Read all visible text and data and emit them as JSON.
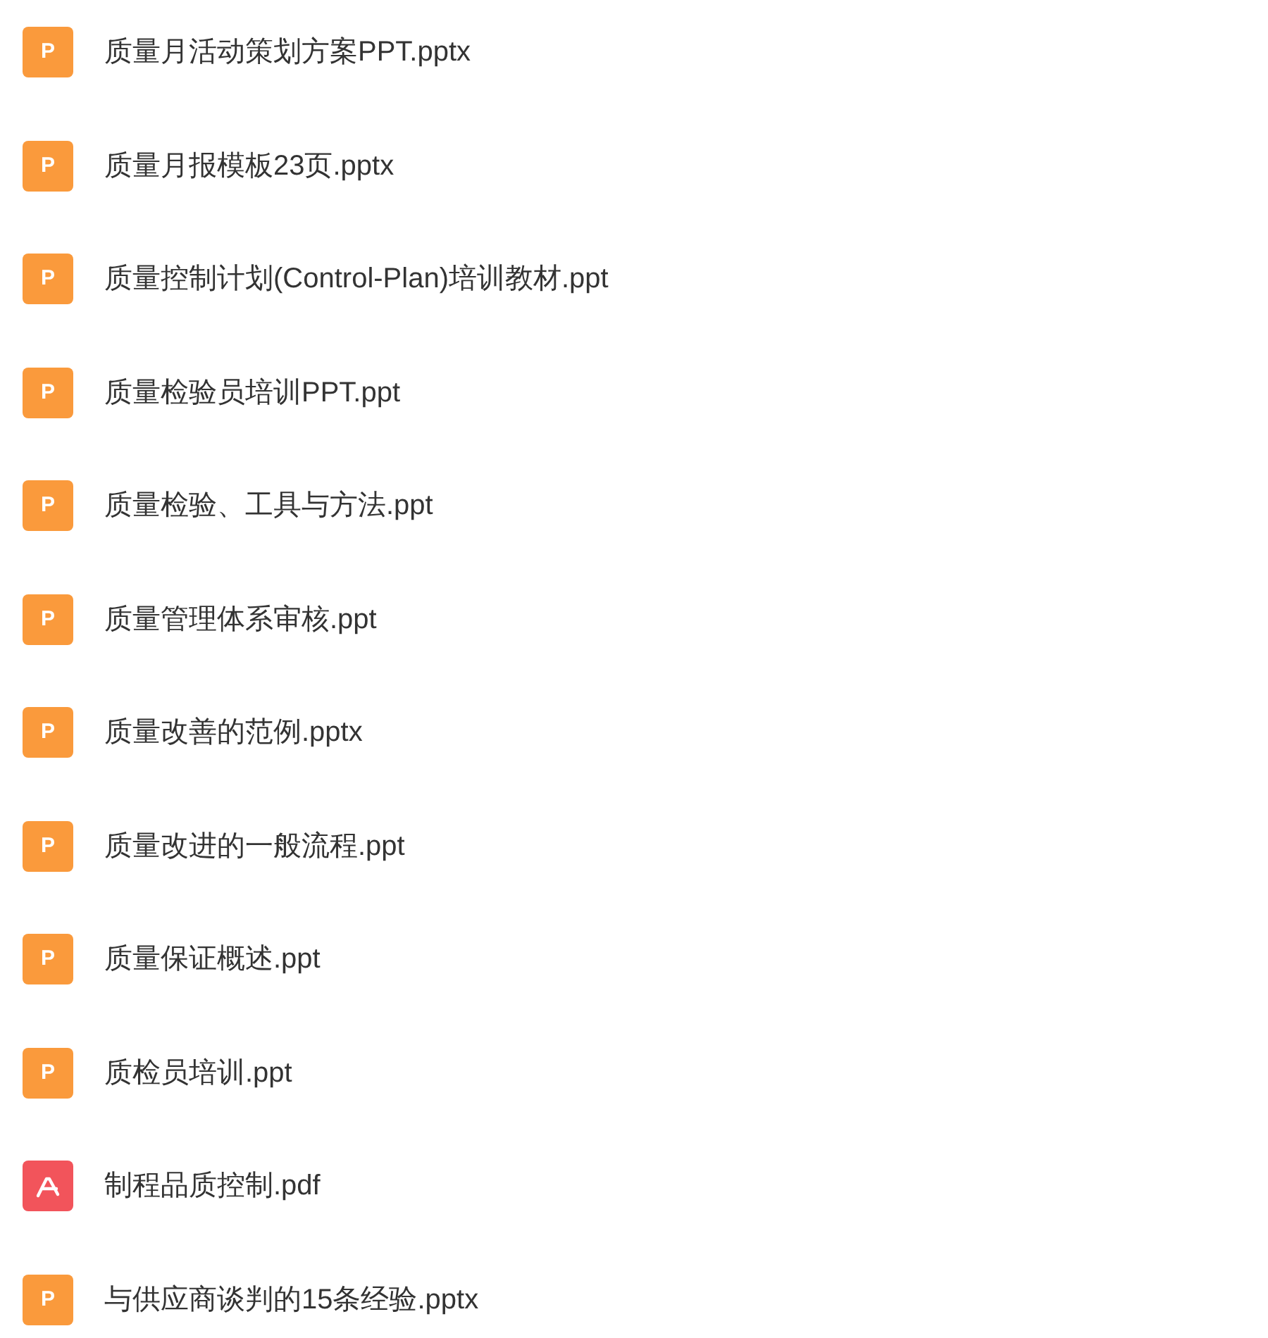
{
  "files": [
    {
      "kind": "ppt",
      "badge": "P",
      "name": "质量月活动策划方案PPT.pptx"
    },
    {
      "kind": "ppt",
      "badge": "P",
      "name": "质量月报模板23页.pptx"
    },
    {
      "kind": "ppt",
      "badge": "P",
      "name": "质量控制计划(Control-Plan)培训教材.ppt"
    },
    {
      "kind": "ppt",
      "badge": "P",
      "name": "质量检验员培训PPT.ppt"
    },
    {
      "kind": "ppt",
      "badge": "P",
      "name": "质量检验、工具与方法.ppt"
    },
    {
      "kind": "ppt",
      "badge": "P",
      "name": "质量管理体系审核.ppt"
    },
    {
      "kind": "ppt",
      "badge": "P",
      "name": "质量改善的范例.pptx"
    },
    {
      "kind": "ppt",
      "badge": "P",
      "name": "质量改进的一般流程.ppt"
    },
    {
      "kind": "ppt",
      "badge": "P",
      "name": "质量保证概述.ppt"
    },
    {
      "kind": "ppt",
      "badge": "P",
      "name": "质检员培训.ppt"
    },
    {
      "kind": "pdf",
      "name": "制程品质控制.pdf"
    },
    {
      "kind": "ppt",
      "badge": "P",
      "name": "与供应商谈判的15条经验.pptx"
    }
  ]
}
